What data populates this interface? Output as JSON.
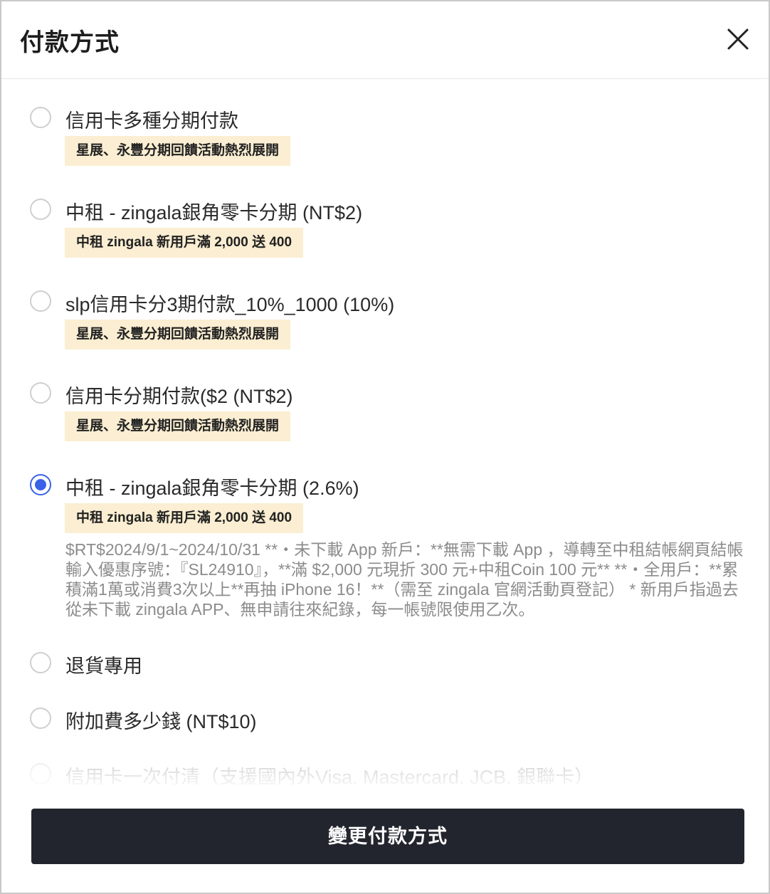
{
  "header": {
    "title": "付款方式"
  },
  "options": [
    {
      "label": "信用卡多種分期付款",
      "badge": "星展、永豐分期回饋活動熱烈展開",
      "selected": false
    },
    {
      "label": "中租 - zingala銀角零卡分期 (NT$2)",
      "badge": "中租 zingala 新用戶滿 2,000 送 400",
      "selected": false
    },
    {
      "label": "slp信用卡分3期付款_10%_1000 (10%)",
      "badge": "星展、永豐分期回饋活動熱烈展開",
      "selected": false
    },
    {
      "label": "信用卡分期付款($2 (NT$2)",
      "badge": "星展、永豐分期回饋活動熱烈展開",
      "selected": false
    },
    {
      "label": "中租 - zingala銀角零卡分期 (2.6%)",
      "badge": "中租 zingala 新用戶滿 2,000 送 400",
      "selected": true,
      "description": "$RT$2024/9/1~2024/10/31 **・未下載 App 新戶：**無需下載 App ，導轉至中租結帳網頁結帳輸入優惠序號：『SL24910』，**滿 $2,000 元現折 300 元+中租Coin 100 元** **・全用戶：**累積滿1萬或消費3次以上**再抽 iPhone 16！**（需至 zingala 官網活動頁登記） * 新用戶指過去從未下載 zingala APP、無申請往來紀錄，每一帳號限使用乙次。"
    },
    {
      "label": "退貨專用",
      "selected": false
    },
    {
      "label": "附加費多少錢 (NT$10)",
      "selected": false
    },
    {
      "label": "信用卡一次付清（支援國內外Visa, Mastercard, JCB, 銀聯卡）",
      "selected": false
    }
  ],
  "footer": {
    "submit_label": "變更付款方式"
  },
  "colors": {
    "accent": "#3a62e8",
    "badge_bg": "#fbeed2",
    "button_bg": "#23252e"
  }
}
